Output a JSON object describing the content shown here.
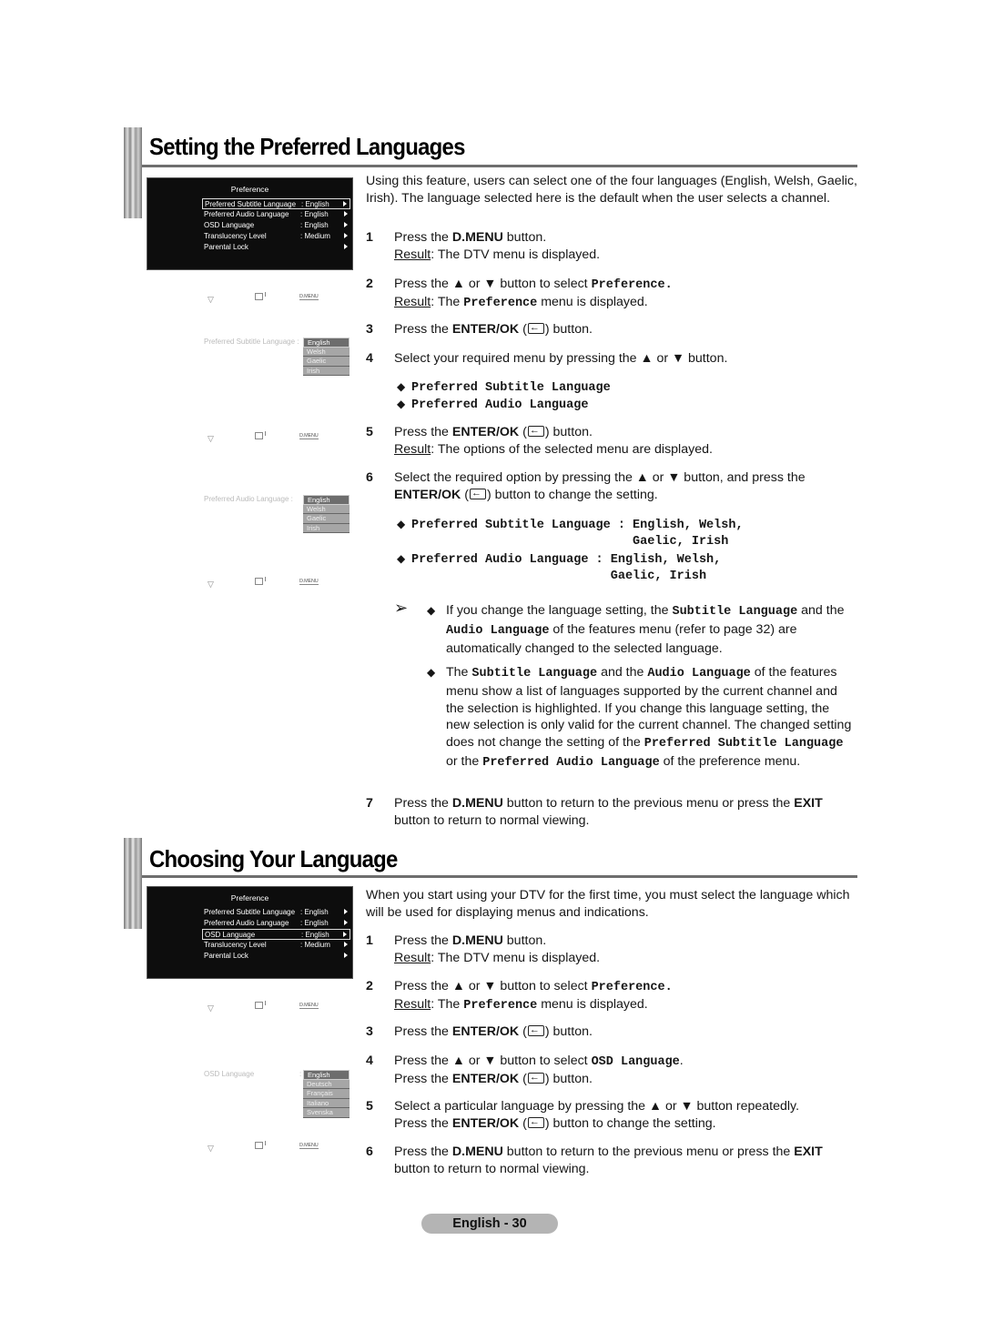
{
  "section1": {
    "title": "Setting the Preferred Languages",
    "osd_menu": {
      "title": "Preference",
      "rows": [
        {
          "label": "Preferred Subtitle Language",
          "value": ": English",
          "selected": true
        },
        {
          "label": "Preferred Audio Language",
          "value": ": English",
          "selected": false
        },
        {
          "label": "OSD Language",
          "value": ": English",
          "selected": false
        },
        {
          "label": "Translucency Level",
          "value": ": Medium",
          "selected": false
        },
        {
          "label": "Parental Lock",
          "value": "",
          "selected": false
        }
      ]
    },
    "nav_menu_label": "D.MENU",
    "subtitle_popup": {
      "label": "Preferred Subtitle Language :",
      "options": [
        "English",
        "Welsh",
        "Gaelic",
        "Irish"
      ],
      "selected": "English"
    },
    "audio_popup": {
      "label": "Preferred Audio Language  :",
      "options": [
        "English",
        "Welsh",
        "Gaelic",
        "Irish"
      ],
      "selected": "English"
    },
    "intro": "Using this feature, users can select one of the four languages (English, Welsh, Gaelic, Irish). The language selected here is the default when the user selects a channel.",
    "steps": [
      {
        "num": "1",
        "pre": "Press the ",
        "bold": "D.MENU",
        "post": " button.",
        "result_label": "Result",
        "result": ": The DTV menu is displayed."
      },
      {
        "num": "2",
        "pre": "Press the ▲ or ▼ button to select ",
        "mono": "Preference.",
        "result_label": "Result",
        "result_pre": ": The ",
        "result_mono": "Preference",
        "result_post": " menu is displayed."
      },
      {
        "num": "3",
        "pre": "Press the ",
        "bold": "ENTER/OK",
        "post_open": " (",
        "post": ") button."
      },
      {
        "num": "4",
        "text": "Select your required menu by pressing the ▲ or ▼ button."
      },
      {
        "num": "5",
        "pre": "Press the ",
        "bold": "ENTER/OK",
        "post_open": " (",
        "post": ") button.",
        "result_label": "Result",
        "result": ": The options of the selected menu are displayed."
      },
      {
        "num": "6",
        "pre": "Select the required option by pressing the ▲ or ▼ button, and press the ",
        "bold": "ENTER/OK",
        "post_open": " (",
        "post": ") button to change the setting."
      },
      {
        "num": "7",
        "pre": "Press the ",
        "bold": "D.MENU",
        "mid": " button to return to the previous menu or press the ",
        "bold2": "EXIT",
        "post": " button to return to normal viewing."
      }
    ],
    "step4_bullets": [
      "Preferred Subtitle Language",
      "Preferred Audio Language"
    ],
    "step6_bullets": [
      {
        "line1": "Preferred Subtitle Language : English, Welsh,",
        "line2": "                              Gaelic, Irish"
      },
      {
        "line1": "Preferred Audio Language : English, Welsh,",
        "line2": "                           Gaelic, Irish"
      }
    ],
    "notes": [
      {
        "t1": "If you change the language setting, the ",
        "m1": "Subtitle Language",
        "t2": " and the ",
        "m2": "Audio Language",
        "t3": " of the features menu (refer to page 32) are automatically changed to the selected language."
      },
      {
        "t1": "The ",
        "m1": "Subtitle Language",
        "t2": " and the ",
        "m2": "Audio Language",
        "t3": " of the features menu show a list of languages supported by the current channel and the selection is highlighted. If you change this language setting, the new selection is only valid for the current channel. The changed setting does not change the setting of the ",
        "m3": "Preferred Subtitle Language",
        "t4": " or the ",
        "m4": "Preferred Audio Language",
        "t5": " of the preference menu."
      }
    ]
  },
  "section2": {
    "title": "Choosing Your Language",
    "osd_menu": {
      "title": "Preference",
      "rows": [
        {
          "label": "Preferred Subtitle Language",
          "value": ": English",
          "selected": false
        },
        {
          "label": "Preferred Audio Language",
          "value": ": English",
          "selected": false
        },
        {
          "label": "OSD Language",
          "value": ": English",
          "selected": true
        },
        {
          "label": "Translucency Level",
          "value": ": Medium",
          "selected": false
        },
        {
          "label": "Parental Lock",
          "value": "",
          "selected": false
        }
      ]
    },
    "nav_menu_label": "D.MENU",
    "osd_popup": {
      "label": "OSD Language",
      "colon": ":",
      "options": [
        "English",
        "Deutsch",
        "Français",
        "Italiano",
        "Svenska"
      ],
      "selected": "English"
    },
    "intro": "When you start using your DTV for the first time, you must select the language which will be used for displaying menus and indications.",
    "steps": [
      {
        "num": "1",
        "pre": "Press the ",
        "bold": "D.MENU",
        "post": " button.",
        "result_label": "Result",
        "result": ": The DTV menu is displayed."
      },
      {
        "num": "2",
        "pre": "Press the ▲ or ▼ button to select ",
        "mono": "Preference.",
        "result_label": "Result",
        "result_pre": ": The ",
        "result_mono": "Preference",
        "result_post": " menu is displayed."
      },
      {
        "num": "3",
        "pre": "Press the ",
        "bold": "ENTER/OK",
        "post_open": " (",
        "post": ") button."
      },
      {
        "num": "4",
        "pre": "Press the ▲ or ▼ button to select ",
        "mono": "OSD Language",
        "post": ".",
        "line2_pre": "Press the ",
        "line2_bold": "ENTER/OK",
        "line2_open": " (",
        "line2_post": ") button."
      },
      {
        "num": "5",
        "text": "Select a particular language by pressing the ▲ or ▼ button repeatedly.",
        "line2_pre": "Press the ",
        "line2_bold": "ENTER/OK",
        "line2_open": " (",
        "line2_post": ") button to change the setting."
      },
      {
        "num": "6",
        "pre": "Press the ",
        "bold": "D.MENU",
        "mid": " button to return to the previous menu or press the ",
        "bold2": "EXIT",
        "post": " button to return to normal viewing."
      }
    ]
  },
  "footer": {
    "page_label": "English - 30"
  }
}
